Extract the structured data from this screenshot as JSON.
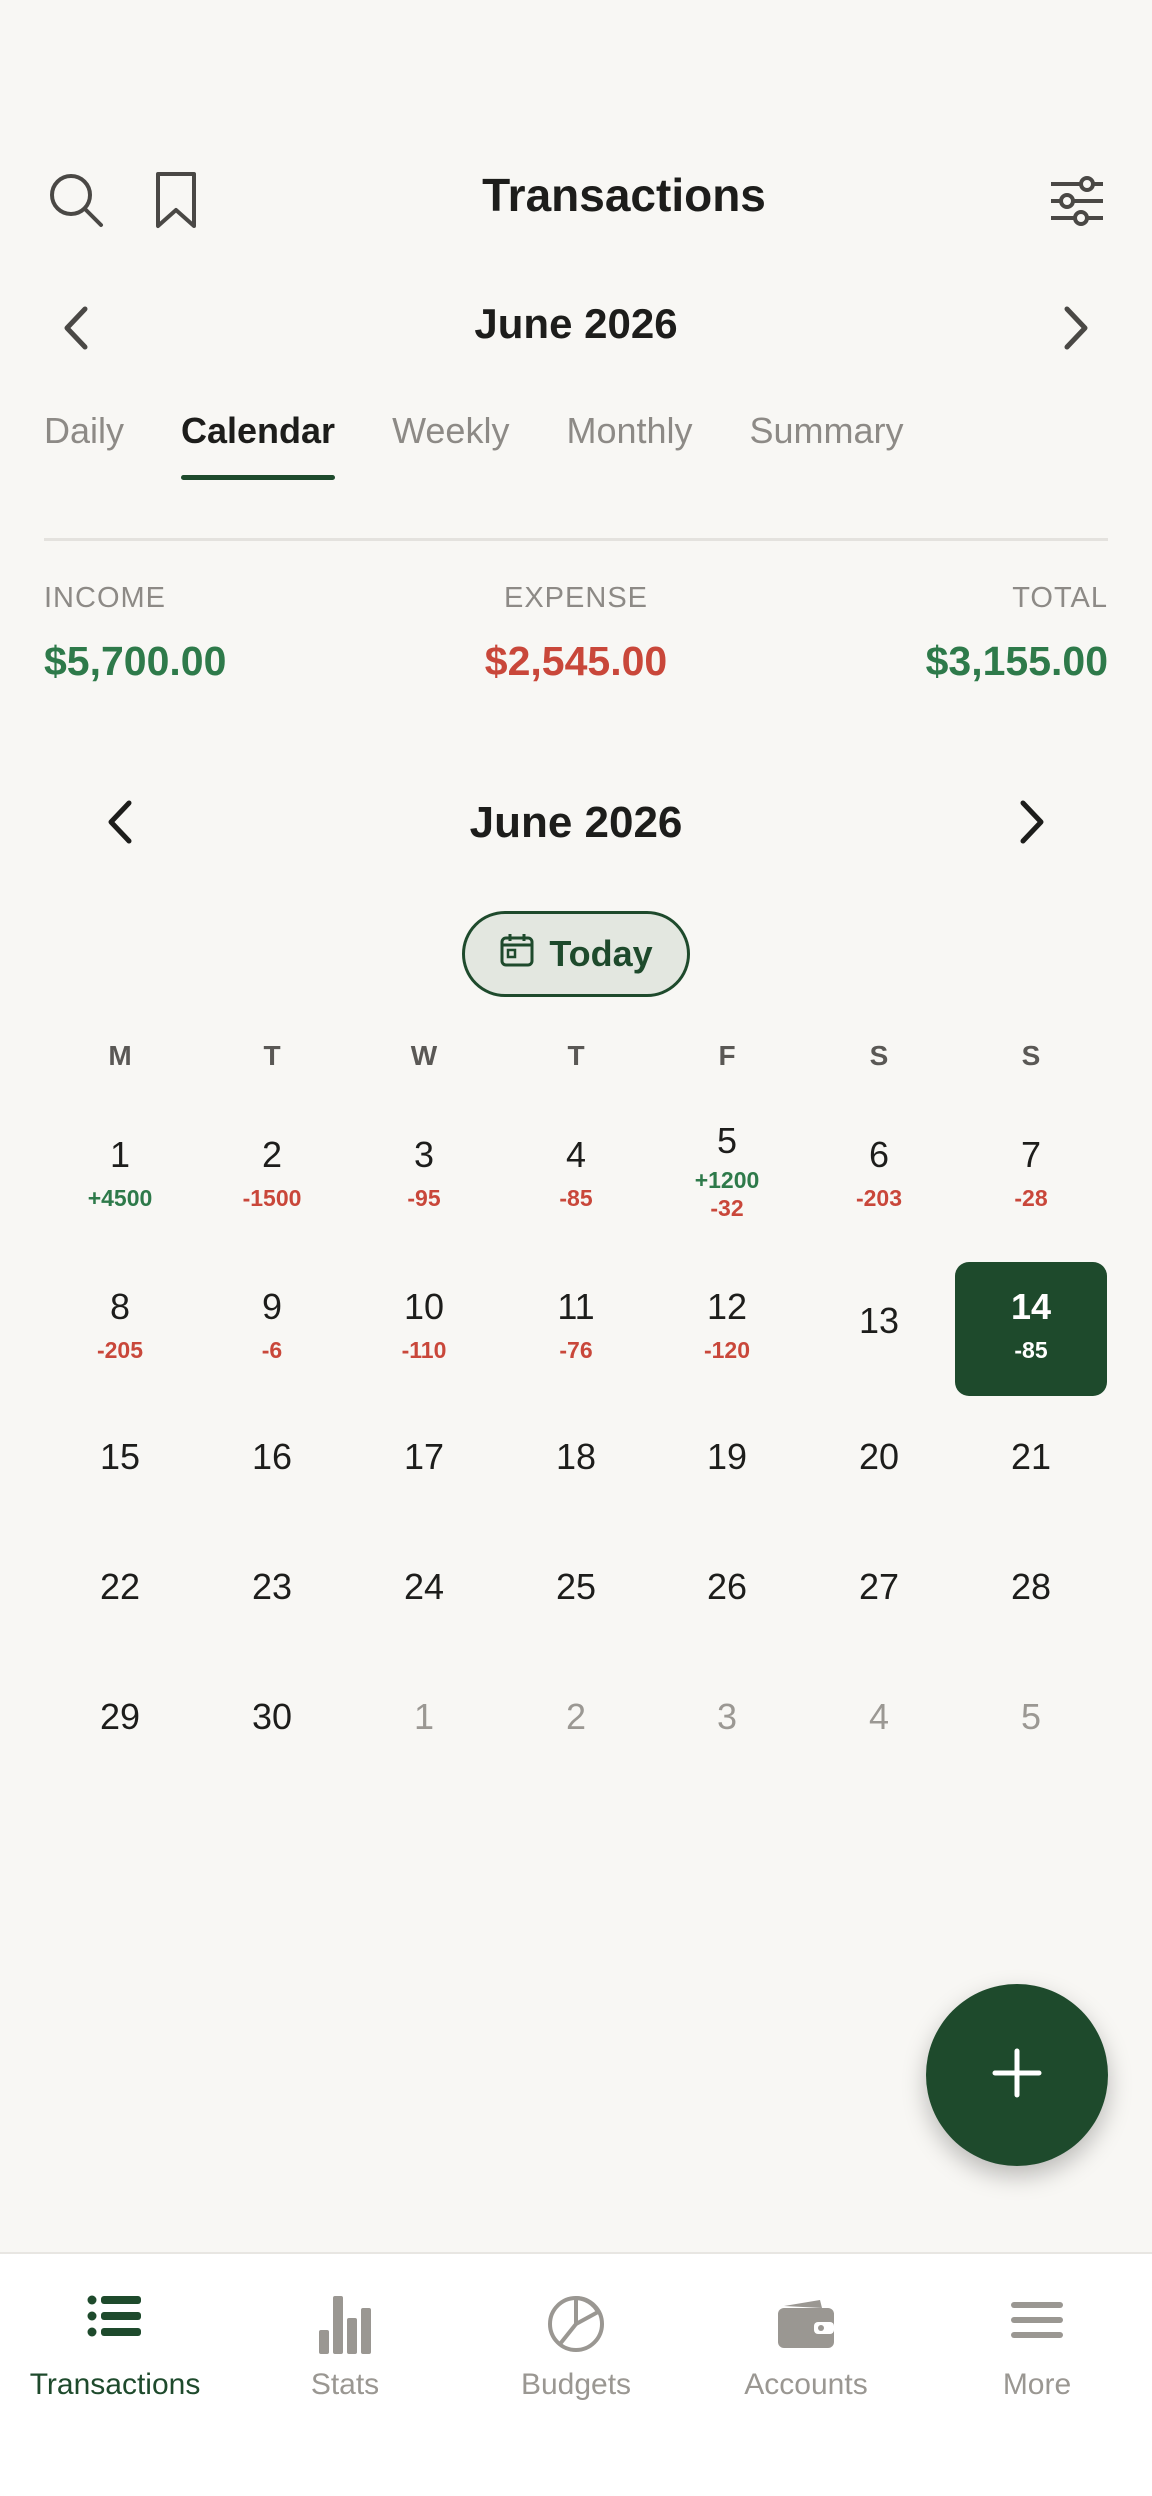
{
  "header": {
    "title": "Transactions",
    "month_label": "June 2026"
  },
  "tabs": [
    {
      "label": "Daily",
      "active": false
    },
    {
      "label": "Calendar",
      "active": true
    },
    {
      "label": "Weekly",
      "active": false
    },
    {
      "label": "Monthly",
      "active": false
    },
    {
      "label": "Summary",
      "active": false
    }
  ],
  "summary": {
    "income_label": "INCOME",
    "income_value": "$5,700.00",
    "expense_label": "EXPENSE",
    "expense_value": "$2,545.00",
    "total_label": "TOTAL",
    "total_value": "$3,155.00"
  },
  "calendar": {
    "month_label": "June 2026",
    "today_label": "Today",
    "weekdays": [
      "M",
      "T",
      "W",
      "T",
      "F",
      "S",
      "S"
    ],
    "weeks": [
      [
        {
          "day": "1",
          "amounts": [
            {
              "text": "+4500",
              "kind": "pos"
            }
          ]
        },
        {
          "day": "2",
          "amounts": [
            {
              "text": "-1500",
              "kind": "neg"
            }
          ]
        },
        {
          "day": "3",
          "amounts": [
            {
              "text": "-95",
              "kind": "neg"
            }
          ]
        },
        {
          "day": "4",
          "amounts": [
            {
              "text": "-85",
              "kind": "neg"
            }
          ]
        },
        {
          "day": "5",
          "amounts": [
            {
              "text": "+1200",
              "kind": "pos"
            },
            {
              "text": "-32",
              "kind": "neg"
            }
          ]
        },
        {
          "day": "6",
          "amounts": [
            {
              "text": "-203",
              "kind": "neg"
            }
          ]
        },
        {
          "day": "7",
          "amounts": [
            {
              "text": "-28",
              "kind": "neg"
            }
          ]
        }
      ],
      [
        {
          "day": "8",
          "amounts": [
            {
              "text": "-205",
              "kind": "neg"
            }
          ]
        },
        {
          "day": "9",
          "amounts": [
            {
              "text": "-6",
              "kind": "neg"
            }
          ]
        },
        {
          "day": "10",
          "amounts": [
            {
              "text": "-110",
              "kind": "neg"
            }
          ]
        },
        {
          "day": "11",
          "amounts": [
            {
              "text": "-76",
              "kind": "neg"
            }
          ]
        },
        {
          "day": "12",
          "amounts": [
            {
              "text": "-120",
              "kind": "neg"
            }
          ]
        },
        {
          "day": "13",
          "amounts": []
        },
        {
          "day": "14",
          "amounts": [
            {
              "text": "-85",
              "kind": "neg"
            }
          ],
          "selected": true
        }
      ],
      [
        {
          "day": "15",
          "amounts": []
        },
        {
          "day": "16",
          "amounts": []
        },
        {
          "day": "17",
          "amounts": []
        },
        {
          "day": "18",
          "amounts": []
        },
        {
          "day": "19",
          "amounts": []
        },
        {
          "day": "20",
          "amounts": []
        },
        {
          "day": "21",
          "amounts": []
        }
      ],
      [
        {
          "day": "22",
          "amounts": []
        },
        {
          "day": "23",
          "amounts": []
        },
        {
          "day": "24",
          "amounts": []
        },
        {
          "day": "25",
          "amounts": []
        },
        {
          "day": "26",
          "amounts": []
        },
        {
          "day": "27",
          "amounts": []
        },
        {
          "day": "28",
          "amounts": []
        }
      ],
      [
        {
          "day": "29",
          "amounts": []
        },
        {
          "day": "30",
          "amounts": []
        },
        {
          "day": "1",
          "amounts": [],
          "other_month": true
        },
        {
          "day": "2",
          "amounts": [],
          "other_month": true
        },
        {
          "day": "3",
          "amounts": [],
          "other_month": true
        },
        {
          "day": "4",
          "amounts": [],
          "other_month": true
        },
        {
          "day": "5",
          "amounts": [],
          "other_month": true
        }
      ]
    ]
  },
  "bottom_nav": [
    {
      "label": "Transactions",
      "icon": "list-icon",
      "active": true
    },
    {
      "label": "Stats",
      "icon": "bar-chart-icon",
      "active": false
    },
    {
      "label": "Budgets",
      "icon": "pie-chart-icon",
      "active": false
    },
    {
      "label": "Accounts",
      "icon": "wallet-icon",
      "active": false
    },
    {
      "label": "More",
      "icon": "menu-icon",
      "active": false
    }
  ],
  "colors": {
    "accent": "#1e4a2c",
    "income": "#2e7a4a",
    "expense": "#c9473a",
    "background": "#f8f7f4"
  }
}
